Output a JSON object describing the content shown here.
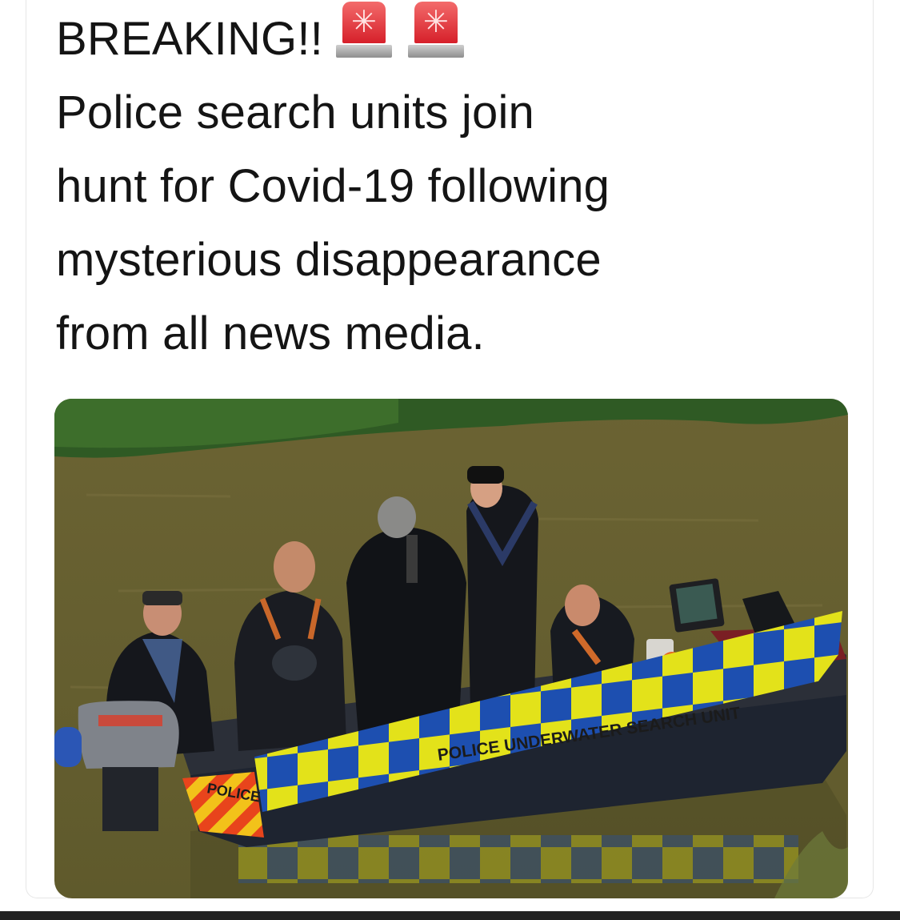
{
  "post": {
    "lines": [
      "BREAKING!!",
      "Police search units join",
      "hunt for Covid-19 following",
      "mysterious disappearance",
      "from all news media."
    ],
    "emoji": [
      "police-car-light",
      "police-car-light"
    ]
  },
  "photo": {
    "boat_label_side": "POLICE UNDERWATER SEARCH UNIT",
    "boat_label_bow": "POLICE",
    "colors": {
      "water": "#6f6434",
      "foliage": "#2f5a24",
      "boat_blue": "#1d4fb0",
      "boat_yellow": "#e3e21a",
      "hull": "#1e2430"
    }
  }
}
